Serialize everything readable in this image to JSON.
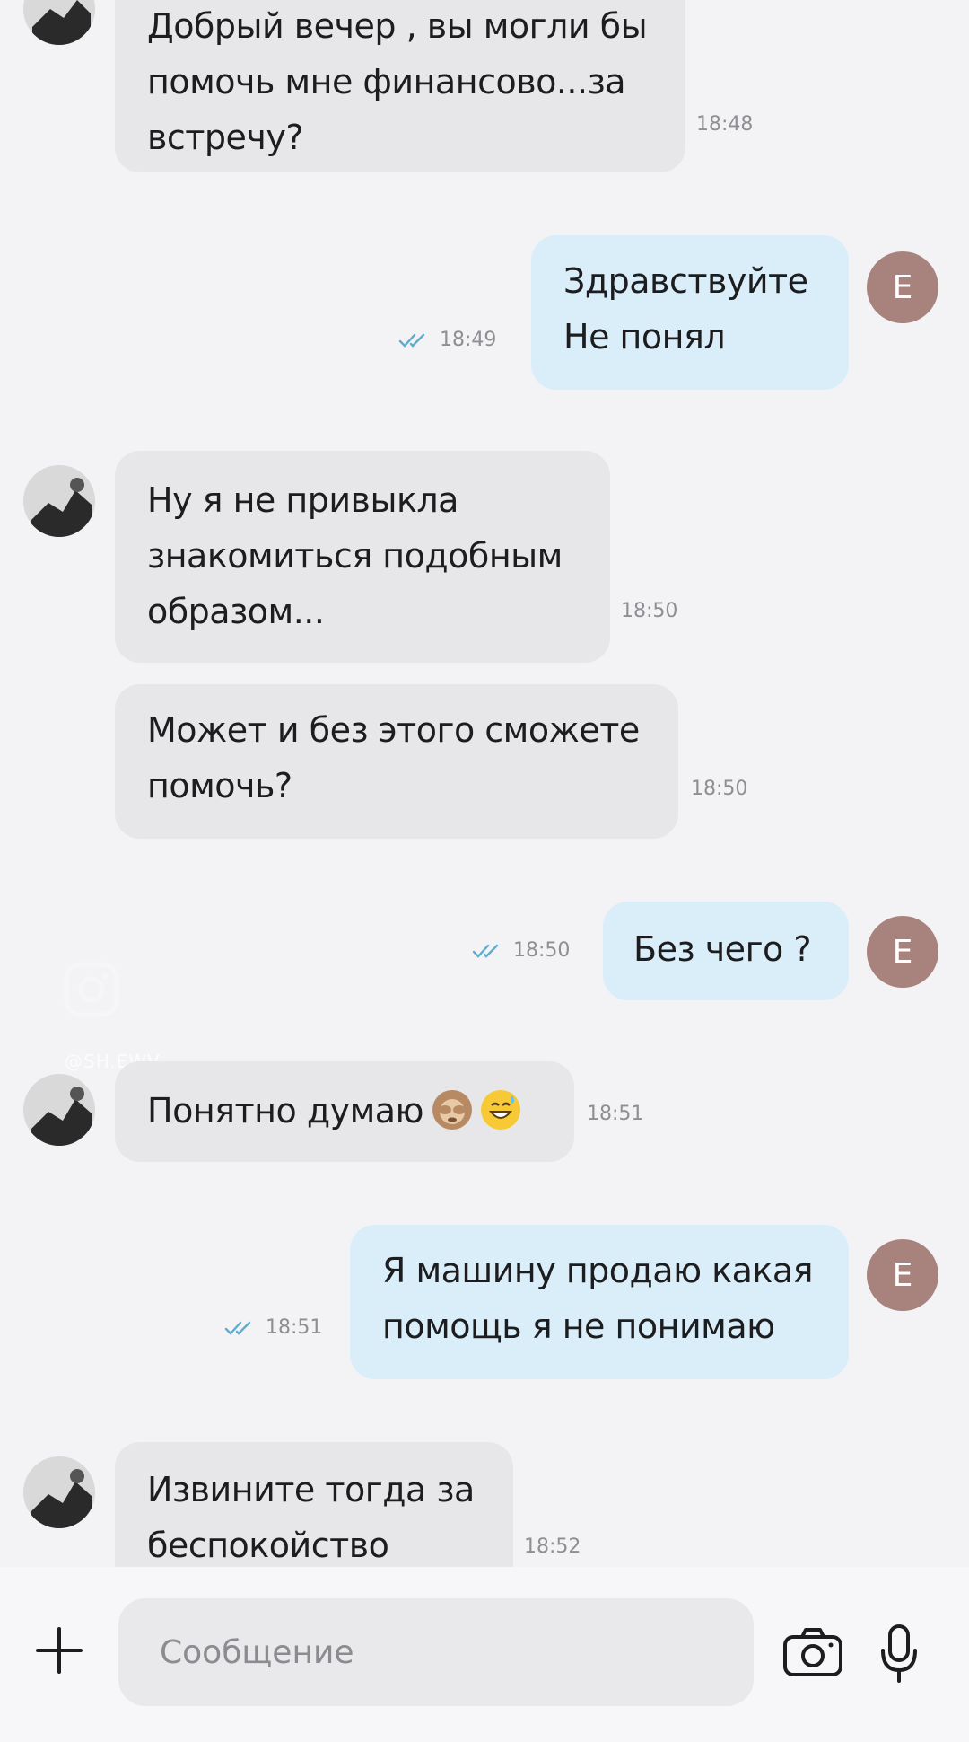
{
  "messages": [
    {
      "text": "Добрый вечер , вы могли бы\nпомочь мне финансово...за\nвстречу?",
      "time": "18:48"
    },
    {
      "text": "Здравствуйте\nНе понял",
      "time": "18:49"
    },
    {
      "text": "Ну я не привыкла\nзнакомиться подобным\nобразом...",
      "time": "18:50"
    },
    {
      "text": "Может и без этого сможете\nпомочь?",
      "time": "18:50"
    },
    {
      "text": "Без чего ?",
      "time": "18:50"
    },
    {
      "text": "Понятно думаю",
      "time": "18:51"
    },
    {
      "text": "Я машину продаю какая\nпомощь я не понимаю",
      "time": "18:51"
    },
    {
      "text": "Извините тогда за\nбеспокойство",
      "time": "18:52"
    }
  ],
  "sender_avatar_letter": "E",
  "watermark": "@SH.EWV",
  "composer": {
    "placeholder": "Сообщение"
  },
  "colors": {
    "background": "#f3f2f4",
    "incoming_bubble": "#e7e6e9",
    "outgoing_bubble": "#daeefa",
    "avatar": "#a8827d",
    "read_ticks": "#5aaed0"
  },
  "icons": [
    "plus-icon",
    "camera-icon",
    "microphone-icon",
    "double-check-icon",
    "see-no-evil-monkey-emoji",
    "grinning-sweat-emoji"
  ]
}
